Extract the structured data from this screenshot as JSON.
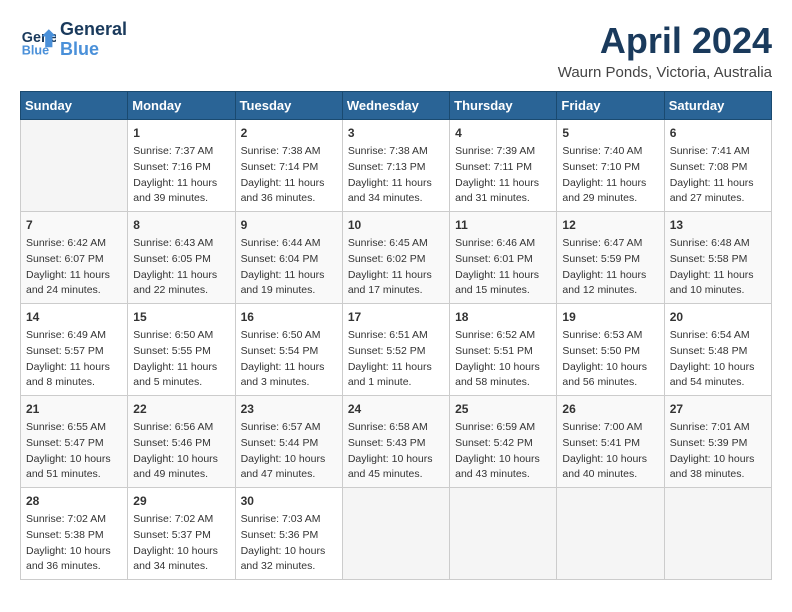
{
  "logo": {
    "line1": "General",
    "line2": "Blue"
  },
  "title": "April 2024",
  "subtitle": "Waurn Ponds, Victoria, Australia",
  "days_of_week": [
    "Sunday",
    "Monday",
    "Tuesday",
    "Wednesday",
    "Thursday",
    "Friday",
    "Saturday"
  ],
  "weeks": [
    [
      {
        "day": "",
        "content": ""
      },
      {
        "day": "1",
        "content": "Sunrise: 7:37 AM\nSunset: 7:16 PM\nDaylight: 11 hours\nand 39 minutes."
      },
      {
        "day": "2",
        "content": "Sunrise: 7:38 AM\nSunset: 7:14 PM\nDaylight: 11 hours\nand 36 minutes."
      },
      {
        "day": "3",
        "content": "Sunrise: 7:38 AM\nSunset: 7:13 PM\nDaylight: 11 hours\nand 34 minutes."
      },
      {
        "day": "4",
        "content": "Sunrise: 7:39 AM\nSunset: 7:11 PM\nDaylight: 11 hours\nand 31 minutes."
      },
      {
        "day": "5",
        "content": "Sunrise: 7:40 AM\nSunset: 7:10 PM\nDaylight: 11 hours\nand 29 minutes."
      },
      {
        "day": "6",
        "content": "Sunrise: 7:41 AM\nSunset: 7:08 PM\nDaylight: 11 hours\nand 27 minutes."
      }
    ],
    [
      {
        "day": "7",
        "content": "Sunrise: 6:42 AM\nSunset: 6:07 PM\nDaylight: 11 hours\nand 24 minutes."
      },
      {
        "day": "8",
        "content": "Sunrise: 6:43 AM\nSunset: 6:05 PM\nDaylight: 11 hours\nand 22 minutes."
      },
      {
        "day": "9",
        "content": "Sunrise: 6:44 AM\nSunset: 6:04 PM\nDaylight: 11 hours\nand 19 minutes."
      },
      {
        "day": "10",
        "content": "Sunrise: 6:45 AM\nSunset: 6:02 PM\nDaylight: 11 hours\nand 17 minutes."
      },
      {
        "day": "11",
        "content": "Sunrise: 6:46 AM\nSunset: 6:01 PM\nDaylight: 11 hours\nand 15 minutes."
      },
      {
        "day": "12",
        "content": "Sunrise: 6:47 AM\nSunset: 5:59 PM\nDaylight: 11 hours\nand 12 minutes."
      },
      {
        "day": "13",
        "content": "Sunrise: 6:48 AM\nSunset: 5:58 PM\nDaylight: 11 hours\nand 10 minutes."
      }
    ],
    [
      {
        "day": "14",
        "content": "Sunrise: 6:49 AM\nSunset: 5:57 PM\nDaylight: 11 hours\nand 8 minutes."
      },
      {
        "day": "15",
        "content": "Sunrise: 6:50 AM\nSunset: 5:55 PM\nDaylight: 11 hours\nand 5 minutes."
      },
      {
        "day": "16",
        "content": "Sunrise: 6:50 AM\nSunset: 5:54 PM\nDaylight: 11 hours\nand 3 minutes."
      },
      {
        "day": "17",
        "content": "Sunrise: 6:51 AM\nSunset: 5:52 PM\nDaylight: 11 hours\nand 1 minute."
      },
      {
        "day": "18",
        "content": "Sunrise: 6:52 AM\nSunset: 5:51 PM\nDaylight: 10 hours\nand 58 minutes."
      },
      {
        "day": "19",
        "content": "Sunrise: 6:53 AM\nSunset: 5:50 PM\nDaylight: 10 hours\nand 56 minutes."
      },
      {
        "day": "20",
        "content": "Sunrise: 6:54 AM\nSunset: 5:48 PM\nDaylight: 10 hours\nand 54 minutes."
      }
    ],
    [
      {
        "day": "21",
        "content": "Sunrise: 6:55 AM\nSunset: 5:47 PM\nDaylight: 10 hours\nand 51 minutes."
      },
      {
        "day": "22",
        "content": "Sunrise: 6:56 AM\nSunset: 5:46 PM\nDaylight: 10 hours\nand 49 minutes."
      },
      {
        "day": "23",
        "content": "Sunrise: 6:57 AM\nSunset: 5:44 PM\nDaylight: 10 hours\nand 47 minutes."
      },
      {
        "day": "24",
        "content": "Sunrise: 6:58 AM\nSunset: 5:43 PM\nDaylight: 10 hours\nand 45 minutes."
      },
      {
        "day": "25",
        "content": "Sunrise: 6:59 AM\nSunset: 5:42 PM\nDaylight: 10 hours\nand 43 minutes."
      },
      {
        "day": "26",
        "content": "Sunrise: 7:00 AM\nSunset: 5:41 PM\nDaylight: 10 hours\nand 40 minutes."
      },
      {
        "day": "27",
        "content": "Sunrise: 7:01 AM\nSunset: 5:39 PM\nDaylight: 10 hours\nand 38 minutes."
      }
    ],
    [
      {
        "day": "28",
        "content": "Sunrise: 7:02 AM\nSunset: 5:38 PM\nDaylight: 10 hours\nand 36 minutes."
      },
      {
        "day": "29",
        "content": "Sunrise: 7:02 AM\nSunset: 5:37 PM\nDaylight: 10 hours\nand 34 minutes."
      },
      {
        "day": "30",
        "content": "Sunrise: 7:03 AM\nSunset: 5:36 PM\nDaylight: 10 hours\nand 32 minutes."
      },
      {
        "day": "",
        "content": ""
      },
      {
        "day": "",
        "content": ""
      },
      {
        "day": "",
        "content": ""
      },
      {
        "day": "",
        "content": ""
      }
    ]
  ]
}
